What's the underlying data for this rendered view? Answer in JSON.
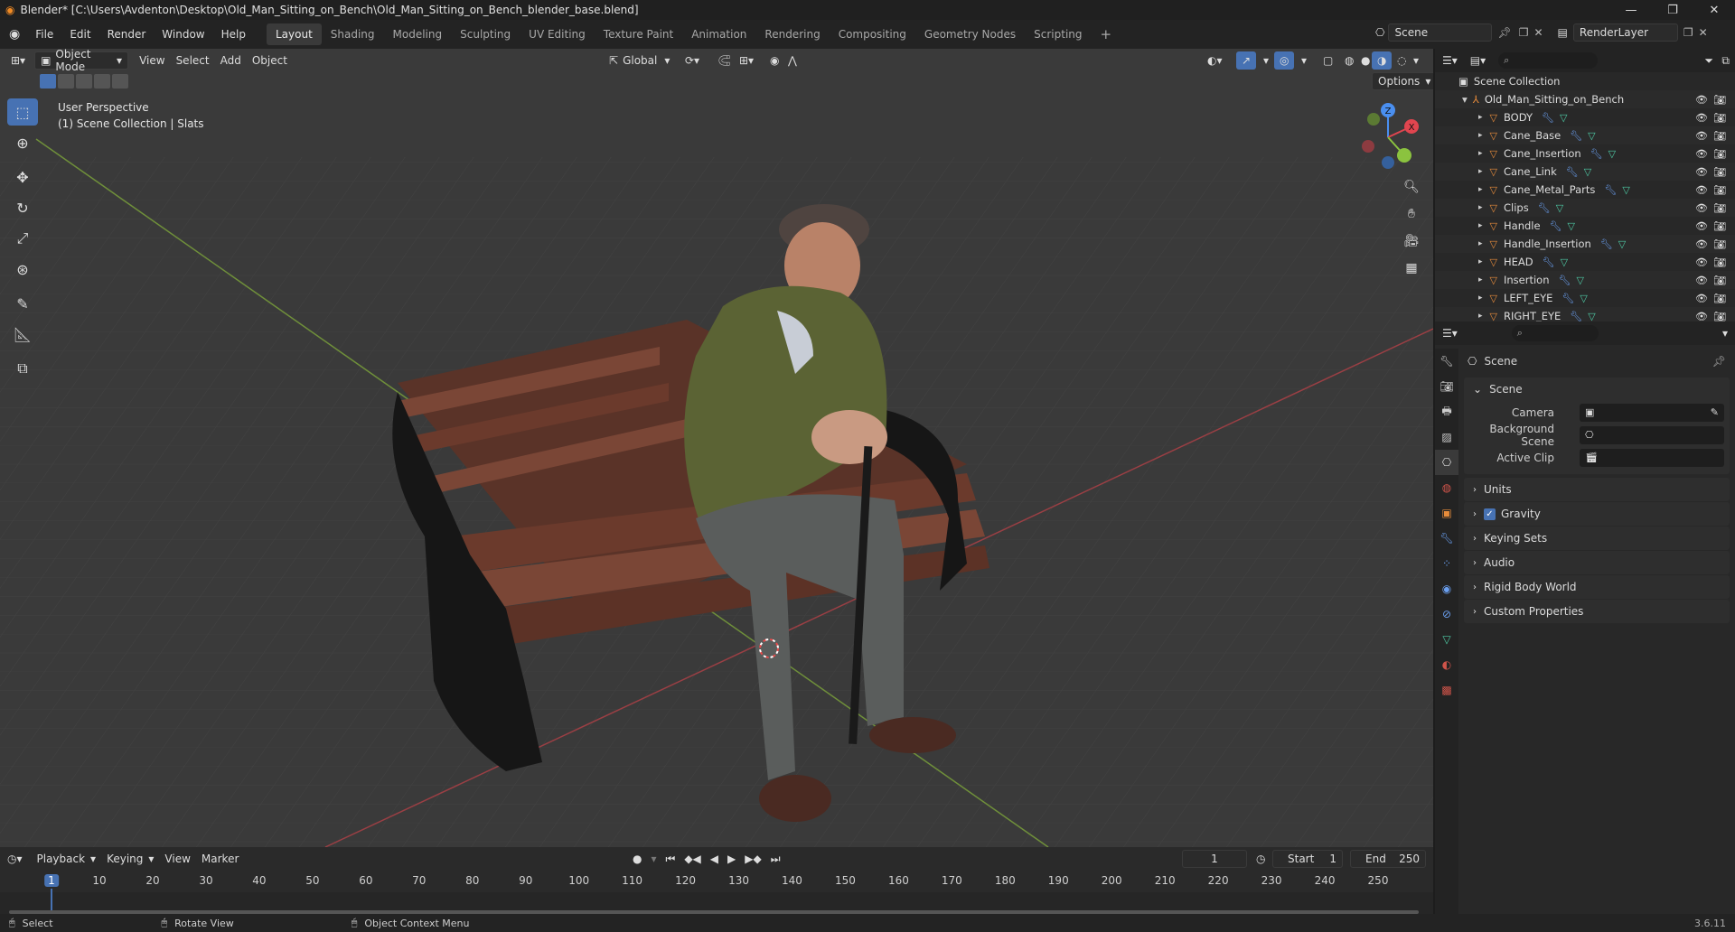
{
  "titlebar": {
    "title": "Blender* [C:\\Users\\Avdenton\\Desktop\\Old_Man_Sitting_on_Bench\\Old_Man_Sitting_on_Bench_blender_base.blend]"
  },
  "menu": [
    "File",
    "Edit",
    "Render",
    "Window",
    "Help"
  ],
  "workspaces": [
    "Layout",
    "Shading",
    "Modeling",
    "Sculpting",
    "UV Editing",
    "Texture Paint",
    "Animation",
    "Rendering",
    "Compositing",
    "Geometry Nodes",
    "Scripting"
  ],
  "active_workspace": "Layout",
  "scene_selector": "Scene",
  "render_layer": "RenderLayer",
  "viewport": {
    "mode": "Object Mode",
    "menus": [
      "View",
      "Select",
      "Add",
      "Object"
    ],
    "orientation": "Global",
    "options_label": "Options",
    "perspective": "User Perspective",
    "collection_info": "(1) Scene Collection | Slats",
    "gizmo_axes": {
      "x": "X",
      "y": "Y",
      "z": "Z"
    }
  },
  "outliner": {
    "root": "Scene Collection",
    "collection": "Old_Man_Sitting_on_Bench",
    "objects": [
      "BODY",
      "Cane_Base",
      "Cane_Insertion",
      "Cane_Link",
      "Cane_Metal_Parts",
      "Clips",
      "Handle",
      "Handle_Insertion",
      "HEAD",
      "Insertion",
      "LEFT_EYE",
      "RIGHT_EYE"
    ]
  },
  "properties": {
    "context": "Scene",
    "panel_title": "Scene",
    "fields": [
      {
        "label": "Camera"
      },
      {
        "label": "Background Scene"
      },
      {
        "label": "Active Clip"
      }
    ],
    "sections": [
      "Units",
      "Gravity",
      "Keying Sets",
      "Audio",
      "Rigid Body World",
      "Custom Properties"
    ],
    "gravity_checked": true
  },
  "timeline": {
    "menus": [
      "Playback",
      "Keying",
      "View",
      "Marker"
    ],
    "current_frame": "1",
    "start_label": "Start",
    "start": "1",
    "end_label": "End",
    "end": "250",
    "ticks": [
      "1",
      "10",
      "20",
      "30",
      "40",
      "50",
      "60",
      "70",
      "80",
      "90",
      "100",
      "110",
      "120",
      "130",
      "140",
      "150",
      "160",
      "170",
      "180",
      "190",
      "200",
      "210",
      "220",
      "230",
      "240",
      "250"
    ]
  },
  "statusbar": {
    "select": "Select",
    "rotate": "Rotate View",
    "context_menu": "Object Context Menu",
    "version": "3.6.11"
  },
  "colors": {
    "accent": "#4772b3",
    "x_axis": "#e0454f",
    "y_axis": "#8bc33f",
    "z_axis": "#4a8ff0"
  }
}
